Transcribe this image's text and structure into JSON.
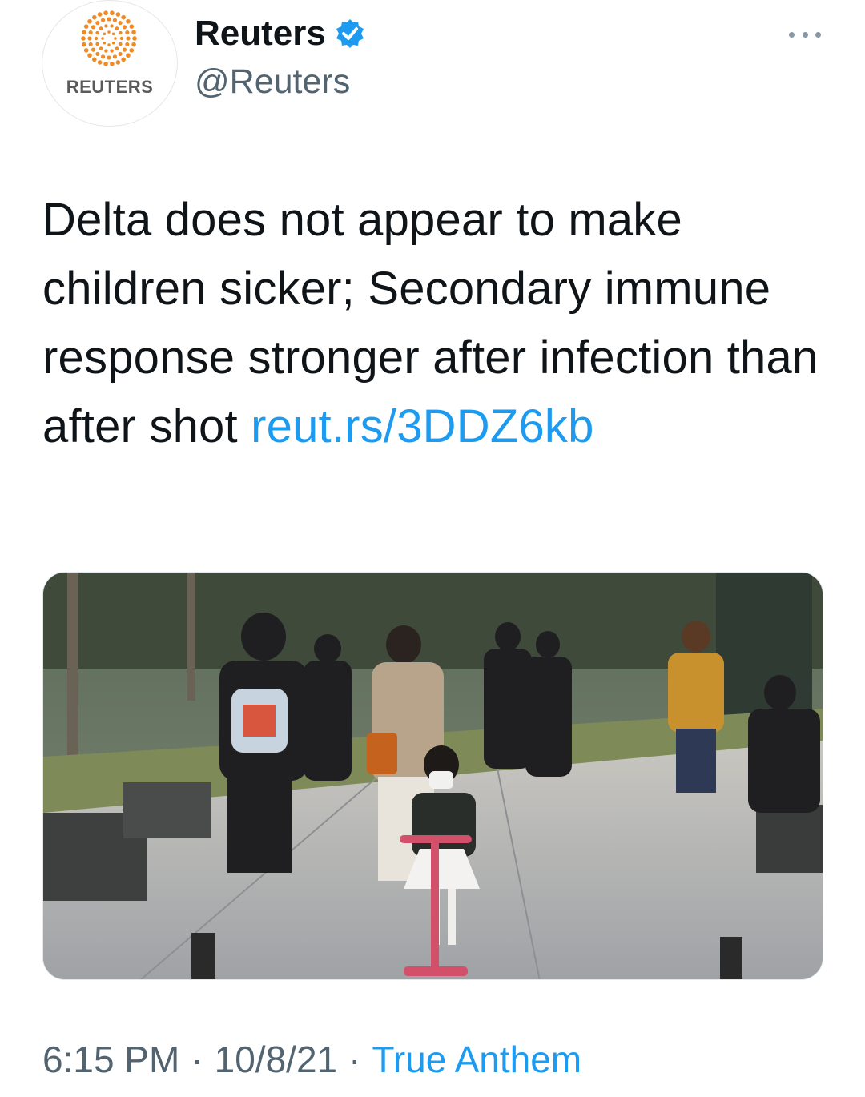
{
  "author": {
    "display_name": "Reuters",
    "handle": "@Reuters",
    "avatar_wordmark": "REUTERS",
    "verified": true
  },
  "menu": {
    "icon": "more-horizontal-icon"
  },
  "tweet": {
    "text": "Delta does not appear to make children sicker; Secondary immune response stronger after infection than after shot ",
    "link": "reut.rs/3DDZ6kb"
  },
  "media": {
    "icon": "photo-icon"
  },
  "meta": {
    "time": "6:15 PM",
    "date": "10/8/21",
    "source": "True Anthem",
    "separator": "·"
  },
  "colors": {
    "link": "#1d9bf0",
    "text": "#0f1419",
    "muted": "#536471",
    "verified_badge": "#1d9bf0",
    "reuters_orange": "#f08a24"
  }
}
